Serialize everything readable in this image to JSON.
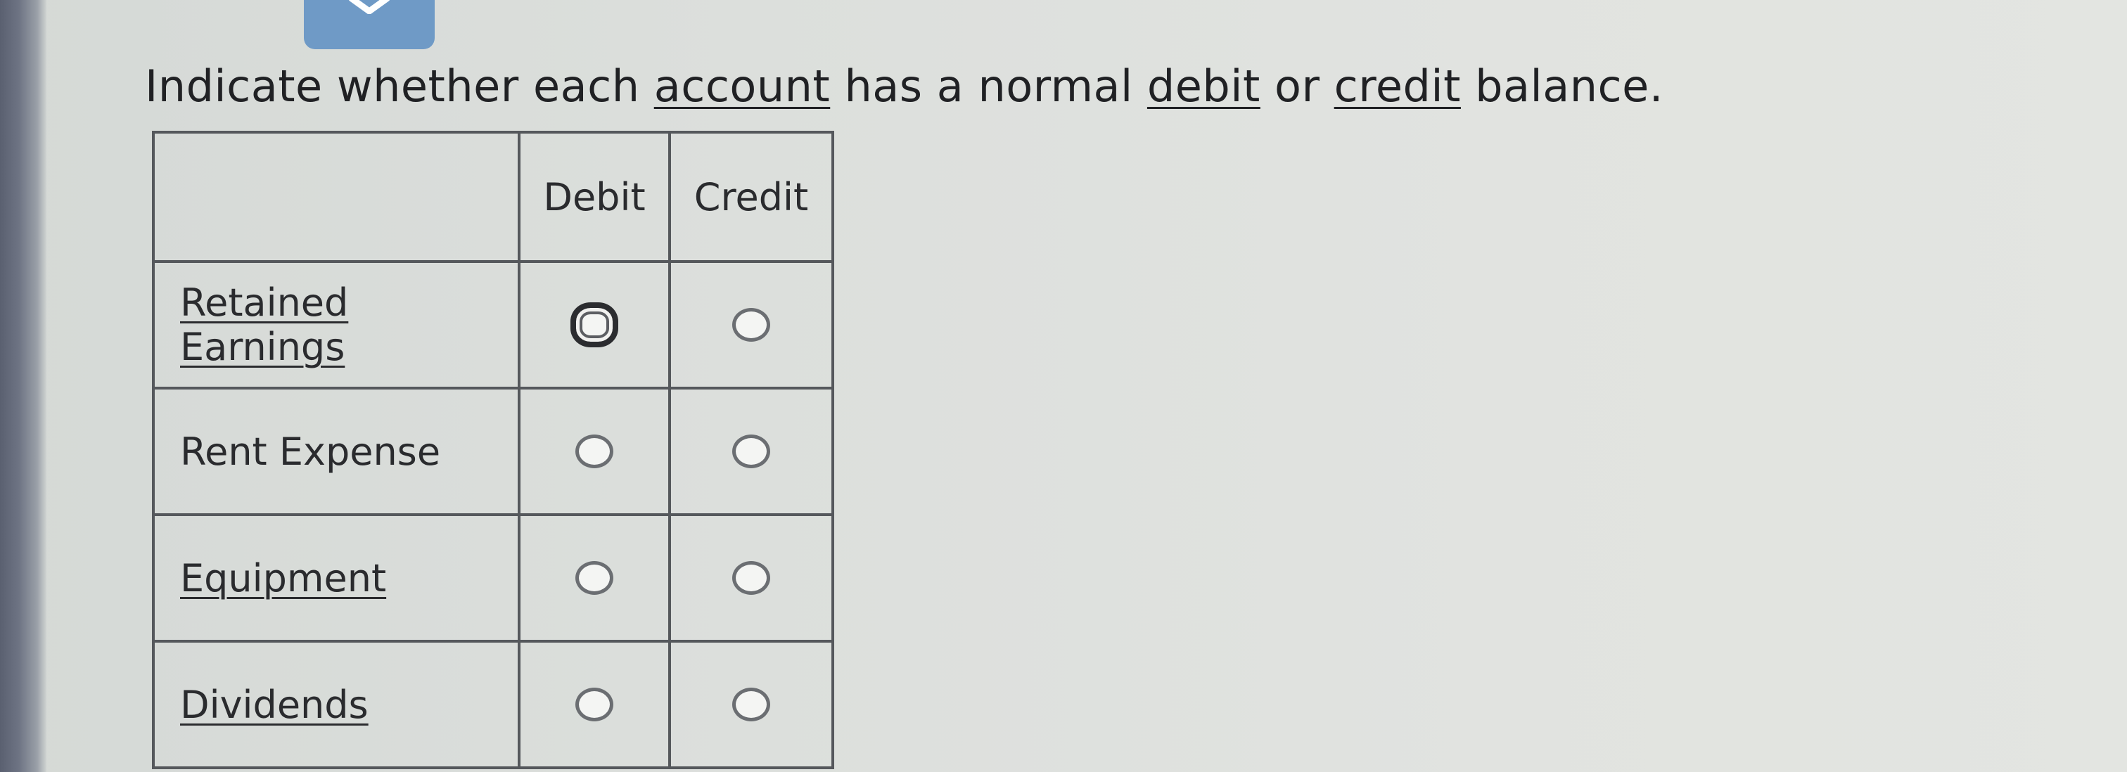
{
  "instruction": {
    "before_account": "Indicate whether each ",
    "account": "account",
    "before_debit": " has a normal ",
    "debit": "debit",
    "between": " or ",
    "credit": "credit",
    "after": " balance."
  },
  "table": {
    "header_blank": "",
    "headers": [
      "Debit",
      "Credit"
    ],
    "rows": [
      {
        "label": "Retained Earnings",
        "debit_selected": false,
        "credit_selected": false
      },
      {
        "label": "Rent Expense",
        "debit_selected": false,
        "credit_selected": false
      },
      {
        "label": "Equipment",
        "debit_selected": false,
        "credit_selected": false
      },
      {
        "label": "Dividends",
        "debit_selected": false,
        "credit_selected": false
      }
    ]
  },
  "icons": {
    "top_button": "chevron-down-icon"
  },
  "colors": {
    "button": "#6f9ac6",
    "background": "#dcdfdc",
    "border": "#55585c"
  }
}
